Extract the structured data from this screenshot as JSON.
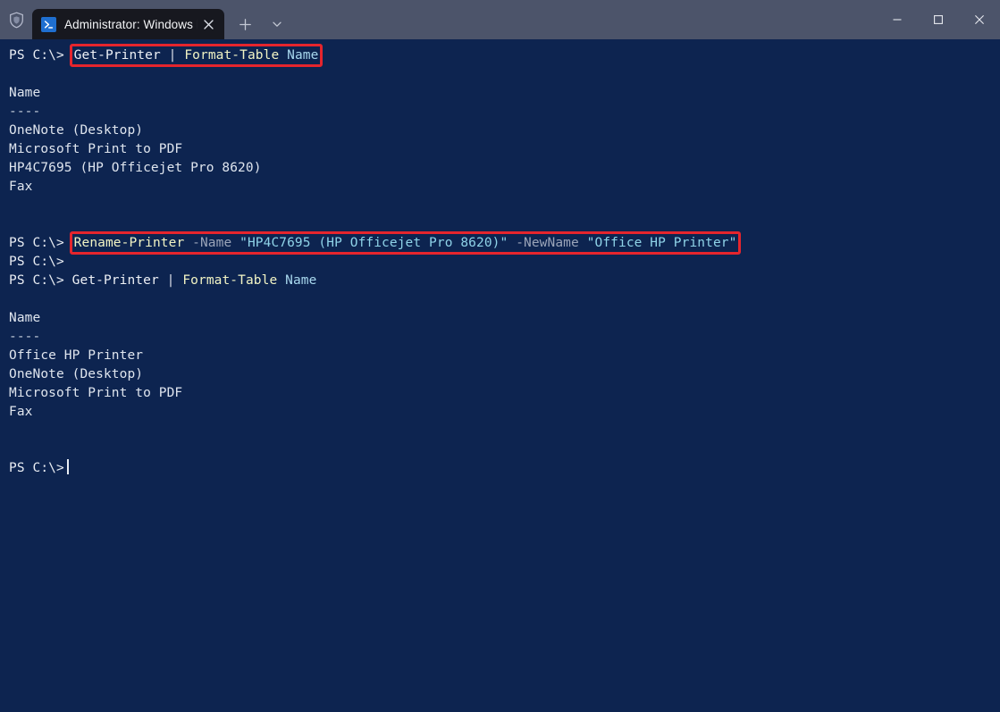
{
  "window": {
    "title": "Administrator: Windows PowerShell",
    "shield_icon": "shield-icon",
    "controls": {
      "minimize": "–",
      "maximize": "☐",
      "close": "✕"
    }
  },
  "tabbar": {
    "tab": {
      "icon": "powershell-icon",
      "label": "Administrator: Windows Pow",
      "close": "✕"
    },
    "new_tab": "+",
    "dropdown": "⌄"
  },
  "colors": {
    "background": "#0d2450",
    "titlebar": "#4c546a",
    "tab_active": "#17181f",
    "highlight_box": "#e5252d",
    "text": "#e8ecf2",
    "command": "#f2f4c4",
    "parameter": "#9aa4b8",
    "string": "#8fd3e8"
  },
  "terminal": {
    "prompt": "PS C:\\>",
    "lines": [
      {
        "type": "command",
        "highlight": true,
        "prompt": "PS C:\\>",
        "tokens": [
          {
            "text": "Get-Printer",
            "cls": "cmd-w"
          },
          {
            "text": " ",
            "cls": "out"
          },
          {
            "text": "|",
            "cls": "pipe"
          },
          {
            "text": " ",
            "cls": "out"
          },
          {
            "text": "Format-Table",
            "cls": "cmd"
          },
          {
            "text": " ",
            "cls": "out"
          },
          {
            "text": "Name",
            "cls": "arg"
          }
        ]
      },
      {
        "type": "blank",
        "text": ""
      },
      {
        "type": "output",
        "text": "Name",
        "cls": "out"
      },
      {
        "type": "output",
        "text": "----",
        "cls": "dim"
      },
      {
        "type": "output",
        "text": "OneNote (Desktop)",
        "cls": "out"
      },
      {
        "type": "output",
        "text": "Microsoft Print to PDF",
        "cls": "out"
      },
      {
        "type": "output",
        "text": "HP4C7695 (HP Officejet Pro 8620)",
        "cls": "out"
      },
      {
        "type": "output",
        "text": "Fax",
        "cls": "out"
      },
      {
        "type": "blank",
        "text": ""
      },
      {
        "type": "blank",
        "text": ""
      },
      {
        "type": "command",
        "highlight": true,
        "prompt": "PS C:\\>",
        "tokens": [
          {
            "text": "Rename-Printer",
            "cls": "cmd"
          },
          {
            "text": " ",
            "cls": "out"
          },
          {
            "text": "-Name",
            "cls": "param"
          },
          {
            "text": " ",
            "cls": "out"
          },
          {
            "text": "\"HP4C7695 (HP Officejet Pro 8620)\"",
            "cls": "str"
          },
          {
            "text": " ",
            "cls": "out"
          },
          {
            "text": "-NewName",
            "cls": "param"
          },
          {
            "text": " ",
            "cls": "out"
          },
          {
            "text": "\"Office HP Printer\"",
            "cls": "str"
          }
        ]
      },
      {
        "type": "command",
        "highlight": false,
        "prompt": "PS C:\\>",
        "tokens": []
      },
      {
        "type": "command",
        "highlight": false,
        "prompt": "PS C:\\>",
        "tokens": [
          {
            "text": " ",
            "cls": "out"
          },
          {
            "text": "Get-Printer",
            "cls": "cmd-w"
          },
          {
            "text": " ",
            "cls": "out"
          },
          {
            "text": "|",
            "cls": "pipe"
          },
          {
            "text": " ",
            "cls": "out"
          },
          {
            "text": "Format-Table",
            "cls": "cmd"
          },
          {
            "text": " ",
            "cls": "out"
          },
          {
            "text": "Name",
            "cls": "arg"
          }
        ]
      },
      {
        "type": "blank",
        "text": ""
      },
      {
        "type": "output",
        "text": "Name",
        "cls": "out"
      },
      {
        "type": "output",
        "text": "----",
        "cls": "dim"
      },
      {
        "type": "output",
        "text": "Office HP Printer",
        "cls": "out"
      },
      {
        "type": "output",
        "text": "OneNote (Desktop)",
        "cls": "out"
      },
      {
        "type": "output",
        "text": "Microsoft Print to PDF",
        "cls": "out"
      },
      {
        "type": "output",
        "text": "Fax",
        "cls": "out"
      },
      {
        "type": "blank",
        "text": ""
      },
      {
        "type": "blank",
        "text": ""
      },
      {
        "type": "cursor-line",
        "highlight": false,
        "prompt": "PS C:\\>",
        "tokens": []
      }
    ]
  }
}
